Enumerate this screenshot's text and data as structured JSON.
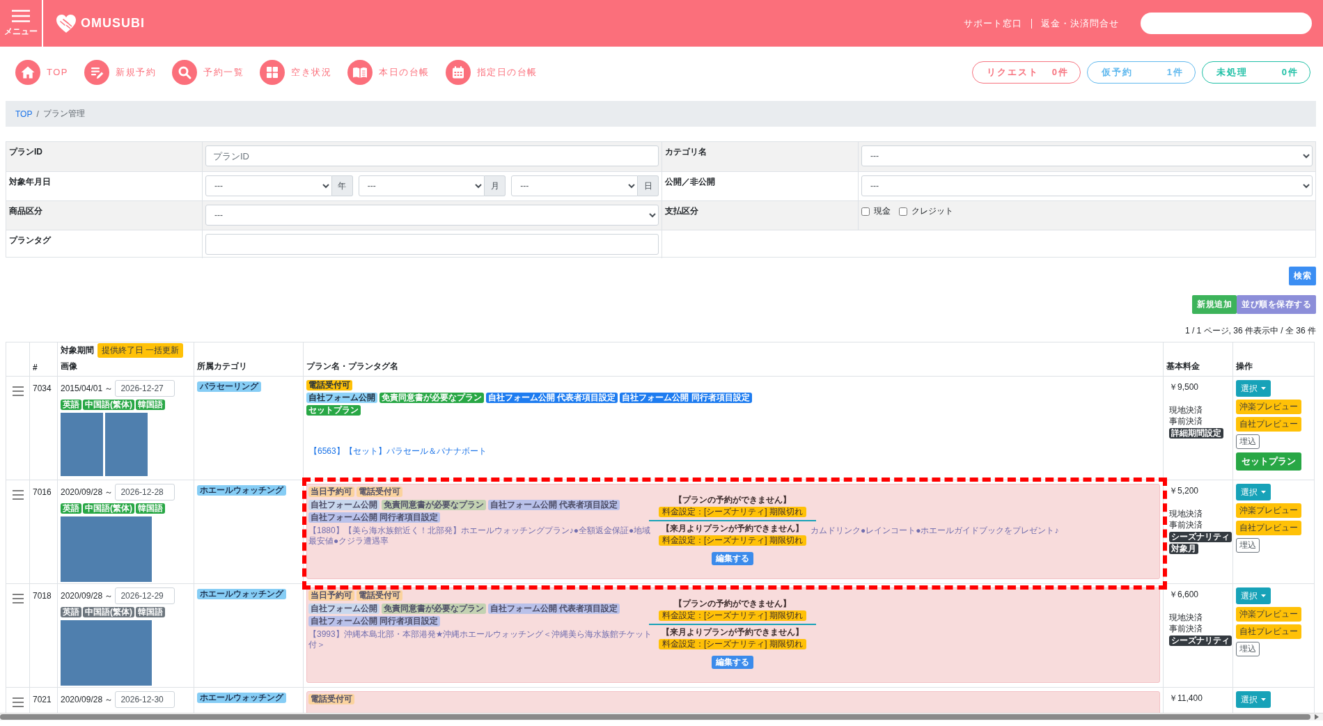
{
  "header": {
    "menu_label": "メニュー",
    "logo": "OMUSUBI",
    "links": [
      "サポート窓口",
      "返金・決済問合せ"
    ]
  },
  "nav": {
    "items": [
      {
        "kind": "home",
        "label": "TOP"
      },
      {
        "kind": "new",
        "label": "新規予約"
      },
      {
        "kind": "search",
        "label": "予約一覧"
      },
      {
        "kind": "grid",
        "label": "空き状況"
      },
      {
        "kind": "book",
        "label": "本日の台帳"
      },
      {
        "kind": "calendar",
        "label": "指定日の台帳"
      }
    ],
    "counters": [
      {
        "label": "リクエスト",
        "count": "0件",
        "color": "#f7737f"
      },
      {
        "label": "仮予約",
        "count": "1件",
        "color": "#5fb8ee"
      },
      {
        "label": "未処理",
        "count": "0件",
        "color": "#1fc0a6"
      }
    ]
  },
  "breadcrumb": {
    "separator": "/",
    "items": [
      {
        "label": "TOP",
        "current": false
      },
      {
        "label": "プラン管理",
        "current": true
      }
    ]
  },
  "filters": {
    "rows": [
      {
        "left": {
          "label": "プランID",
          "kind": "text",
          "placeholder": "プランID"
        },
        "right": {
          "label": "カテゴリ名",
          "kind": "select",
          "value": "---"
        }
      },
      {
        "left": {
          "label": "対象年月日",
          "kind": "date",
          "parts": [
            {
              "value": "---",
              "unit": "年"
            },
            {
              "value": "---",
              "unit": "月"
            },
            {
              "value": "---",
              "unit": "日"
            }
          ]
        },
        "right": {
          "label": "公開／非公開",
          "kind": "select",
          "value": "---"
        }
      },
      {
        "left": {
          "label": "商品区分",
          "kind": "select",
          "value": "---"
        },
        "right": {
          "label": "支払区分",
          "kind": "checks",
          "options": [
            {
              "label": "現金",
              "checked": false
            },
            {
              "label": "クレジット",
              "checked": false
            }
          ]
        }
      },
      {
        "left": {
          "label": "プランタグ",
          "kind": "text"
        }
      }
    ],
    "search_button": "検索"
  },
  "list_actions": [
    {
      "kind": "add",
      "label": "新規追加"
    },
    {
      "kind": "save_order",
      "label": "並び順を保存する"
    }
  ],
  "pagination": "1 / 1 ページ, 36 件表示中 / 全 36 件",
  "table": {
    "headers": {
      "id": "#",
      "period": "対象期間",
      "bulk_update": "提供終了日 一括更新",
      "image": "画像",
      "category": "所属カテゴリ",
      "plan": "プラン名・プランタグ名",
      "price": "基本料金",
      "actions": "操作"
    },
    "rows": [
      {
        "id": "7034",
        "start": "2015/04/01 ～",
        "end": "2026-12-27",
        "languages": [
          {
            "label": "英語",
            "active": true
          },
          {
            "label": "中国語(繁体)",
            "active": true
          },
          {
            "label": "韓国語",
            "active": true
          }
        ],
        "images": [
          {
            "kind": "photo"
          },
          {
            "kind": "photo"
          }
        ],
        "categories": [
          "パラセーリング"
        ],
        "unavailable": false,
        "highlighted": false,
        "tags": [
          [
            {
              "label": "電話受付可",
              "color": "#ffc107"
            }
          ],
          [
            {
              "label": "自社フォーム公開",
              "color": "#8fd3f8"
            },
            {
              "label": "免責同意書が必要なプラン",
              "color": "#28a745"
            },
            {
              "label": "自社フォーム公開 代表者項目設定",
              "color": "#1e7cf0"
            },
            {
              "label": "自社フォーム公開 同行者項目設定",
              "color": "#1e7cf0"
            }
          ],
          [
            {
              "label": "セットプラン",
              "color": "#28a745"
            }
          ]
        ],
        "title": "【6563】【セット】パラセール＆バナナボート",
        "price": "￥9,500",
        "payments": [
          "現地決済",
          "事前決済"
        ],
        "price_badges": [
          "詳細期間設定"
        ],
        "buttons": [
          {
            "kind": "dropdown",
            "label": "選択"
          },
          {
            "kind": "preview",
            "label": "沖楽プレビュー"
          },
          {
            "kind": "preview",
            "label": "自社プレビュー"
          },
          {
            "kind": "embed",
            "label": "埋込"
          },
          {
            "kind": "set",
            "label": "セットプラン"
          }
        ]
      },
      {
        "id": "7016",
        "start": "2020/09/28 ～",
        "end": "2026-12-28",
        "languages": [
          {
            "label": "英語",
            "active": true
          },
          {
            "label": "中国語(繁体)",
            "active": true
          },
          {
            "label": "韓国語",
            "active": true
          }
        ],
        "images": [
          {
            "kind": "photo"
          }
        ],
        "categories": [
          "ホエールウォッチング"
        ],
        "unavailable": true,
        "highlighted": true,
        "tags": [
          [
            {
              "label": "当日予約可",
              "color": "#fbd39e"
            },
            {
              "label": "電話受付可",
              "color": "#fbd39e"
            }
          ],
          [
            {
              "label": "自社フォーム公開",
              "color": "#c9d8ee"
            },
            {
              "label": "免責同意書が必要なプラン",
              "color": "#c3d2b2"
            },
            {
              "label": "自社フォーム公開 代表者項目設定",
              "color": "#b9c1ea"
            },
            {
              "label": "自社フォーム公開 同行者項目設定",
              "color": "#b9c1ea"
            }
          ]
        ],
        "title": "【1880】【美ら海水族館近く！北部発】ホエールウォッチングプラン♪●全額返金保証●地域最安値●クジラ遭遇率",
        "title_end": "カムドリンク●レインコート●ホエールガイドブックをプレゼント♪",
        "notices": [
          {
            "message": "【プランの予約ができません】",
            "reason": "料金設定：[シーズナリティ] 期限切れ"
          },
          {
            "message": "【来月よりプランが予約できません】",
            "reason": "料金設定：[シーズナリティ] 期限切れ"
          }
        ],
        "edit_button": "編集する",
        "price": "￥5,200",
        "payments": [
          "現地決済",
          "事前決済"
        ],
        "price_badges": [
          "シーズナリティ",
          "対象月"
        ],
        "buttons": [
          {
            "kind": "dropdown",
            "label": "選択"
          },
          {
            "kind": "preview",
            "label": "沖楽プレビュー"
          },
          {
            "kind": "preview",
            "label": "自社プレビュー"
          },
          {
            "kind": "embed",
            "label": "埋込"
          }
        ]
      },
      {
        "id": "7018",
        "start": "2020/09/28 ～",
        "end": "2026-12-29",
        "languages": [
          {
            "label": "英語",
            "active": false
          },
          {
            "label": "中国語(繁体)",
            "active": false
          },
          {
            "label": "韓国語",
            "active": false
          }
        ],
        "images": [
          {
            "kind": "photo"
          }
        ],
        "categories": [
          "ホエールウォッチング"
        ],
        "unavailable": true,
        "highlighted": false,
        "tags": [
          [
            {
              "label": "当日予約可",
              "color": "#fbd39e"
            },
            {
              "label": "電話受付可",
              "color": "#fbd39e"
            }
          ],
          [
            {
              "label": "自社フォーム公開",
              "color": "#c9d8ee"
            },
            {
              "label": "免責同意書が必要なプラン",
              "color": "#c3d2b2"
            },
            {
              "label": "自社フォーム公開 代表者項目設定",
              "color": "#b9c1ea"
            },
            {
              "label": "自社フォーム公開 同行者項目設定",
              "color": "#b9c1ea"
            }
          ]
        ],
        "title": "【3993】沖縄本島北部・本部港発★沖縄ホエールウォッチング＜沖縄美ら海水族館チケット付＞",
        "notices": [
          {
            "message": "【プランの予約ができません】",
            "reason": "料金設定：[シーズナリティ] 期限切れ"
          },
          {
            "message": "【来月よりプランが予約できません】",
            "reason": "料金設定：[シーズナリティ] 期限切れ"
          }
        ],
        "edit_button": "編集する",
        "price": "￥6,600",
        "payments": [
          "現地決済",
          "事前決済"
        ],
        "price_badges": [
          "シーズナリティ"
        ],
        "buttons": [
          {
            "kind": "dropdown",
            "label": "選択"
          },
          {
            "kind": "preview",
            "label": "沖楽プレビュー"
          },
          {
            "kind": "preview",
            "label": "自社プレビュー"
          },
          {
            "kind": "embed",
            "label": "埋込"
          }
        ]
      },
      {
        "id": "7021",
        "start": "2020/09/28 ～",
        "end": "2026-12-30",
        "categories": [
          "ホエールウォッチング"
        ],
        "unavailable": true,
        "highlighted": false,
        "tags": [
          [
            {
              "label": "電話受付可",
              "color": "#fbd39e"
            }
          ]
        ],
        "price": "￥11,400",
        "buttons": [
          {
            "kind": "dropdown",
            "label": "選択"
          }
        ]
      }
    ]
  }
}
